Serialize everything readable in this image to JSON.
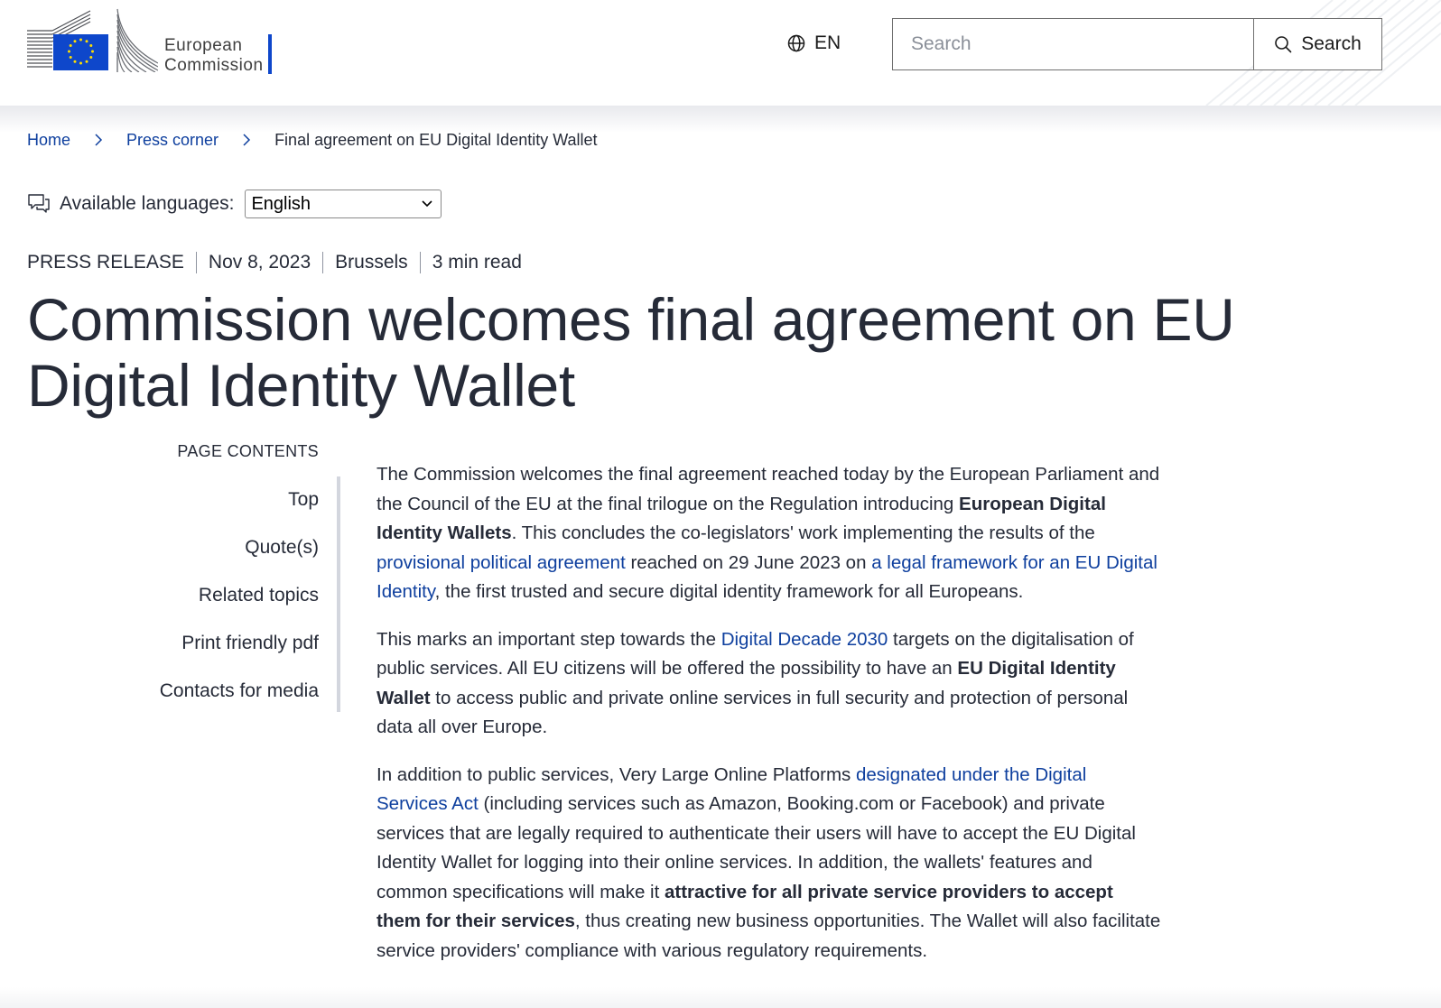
{
  "header": {
    "logo_line1": "European",
    "logo_line2": "Commission",
    "language_code": "EN",
    "search_placeholder": "Search",
    "search_button_label": "Search",
    "accent_color": "#0e47cb"
  },
  "breadcrumb": {
    "items": [
      "Home",
      "Press corner"
    ],
    "current": "Final agreement on EU Digital Identity Wallet"
  },
  "languages": {
    "label": "Available languages:",
    "selected": "English"
  },
  "meta": {
    "type": "PRESS RELEASE",
    "date": "Nov 8, 2023",
    "location": "Brussels",
    "read_time": "3 min read"
  },
  "title": "Commission welcomes final agreement on EU Digital Identity Wallet",
  "toc": {
    "heading": "PAGE CONTENTS",
    "items": [
      "Top",
      "Quote(s)",
      "Related topics",
      "Print friendly pdf",
      "Contacts for media"
    ]
  },
  "body": {
    "p1": {
      "t1": "The Commission welcomes the final agreement reached today by the European Parliament and the Council of the EU at the final trilogue on the Regulation introducing ",
      "b1": "European Digital Identity Wallets",
      "t2": ". This concludes the co-legislators' work implementing the results of the ",
      "l1": "provisional political agreement",
      "t3": " reached on 29 June 2023 on ",
      "l2": "a legal framework for an EU Digital Identity",
      "t4": ", the first trusted and secure digital identity framework for all Europeans."
    },
    "p2": {
      "t1": "This marks an important step towards the ",
      "l1": "Digital Decade 2030",
      "t2": " targets on the digitalisation of public services. All EU citizens will be offered the possibility to have an ",
      "b1": "EU Digital Identity Wallet",
      "t3": " to access public and private online services in full security and protection of personal data all over Europe."
    },
    "p3": {
      "t1": "In addition to public services, Very Large Online Platforms ",
      "l1": "designated under the Digital Services Act",
      "t2": " (including services such as Amazon, Booking.com or Facebook) and private services that are legally required to authenticate their users will have to accept the EU Digital Identity Wallet for logging into their online services. In addition, the wallets' features and common specifications will make it ",
      "b1": "attractive for all private service providers to accept them for their services",
      "t3": ", thus creating new business opportunities. The Wallet will also facilitate service providers' compliance with various regulatory requirements."
    }
  }
}
